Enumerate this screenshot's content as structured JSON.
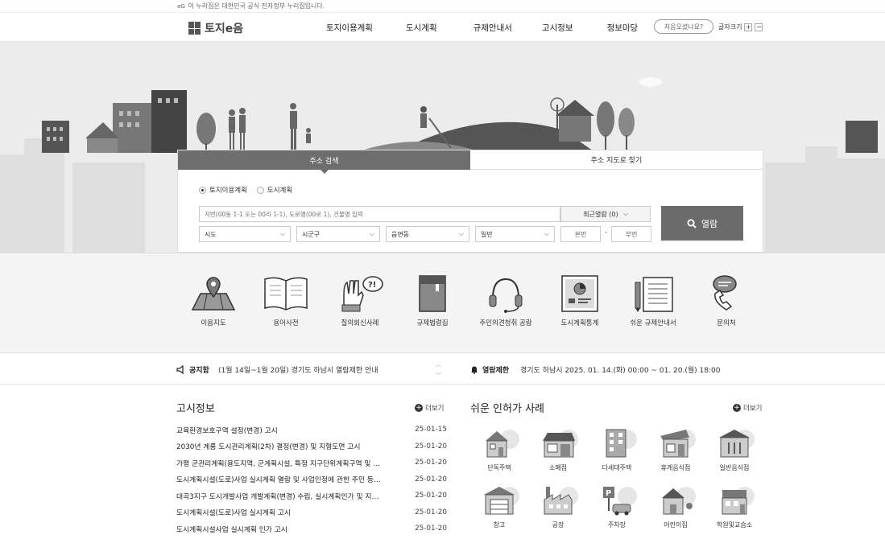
{
  "topbar": {
    "logo_text": "eG",
    "text": "이 누리집은 대한민국 공식 전자정부 누리집입니다."
  },
  "header": {
    "logo": "토지e음",
    "nav": [
      "토지이용계획",
      "도시계획",
      "규제안내서",
      "고시정보",
      "정보마당"
    ],
    "search_placeholder": "처음오셨나요?",
    "font_size_label": "글자크기",
    "font_plus": "+",
    "font_minus": "−"
  },
  "search": {
    "tabs": [
      "주소 검색",
      "주소 지도로 찾기"
    ],
    "radios": [
      "토지이용계획",
      "도시계획"
    ],
    "address_placeholder": "지번(00동 1-1 또는 00리 1-1), 도로명(00로 1), 건물명 입력",
    "recent": "최근열람 (0)",
    "selects": [
      "시도",
      "시군구",
      "읍면동",
      "일반"
    ],
    "bonbun": "본번",
    "bubun": "부번",
    "dash": "-",
    "view_button": "열람"
  },
  "quick_menu": [
    "이음지도",
    "용어사전",
    "질의회신사례",
    "규제법령집",
    "주민의견청취 공람",
    "도시계획통계",
    "쉬운 규제안내서",
    "문의처"
  ],
  "notice": {
    "label": "공지함",
    "text": "(1월 14일~1월 20일) 경기도 하남시 열람제한 안내",
    "restrict_label": "열람제한",
    "restrict_text": "경기도 하남시 2025. 01. 14.(화) 00:00 ~ 01. 20.(월) 18:00"
  },
  "gosi": {
    "title": "고시정보",
    "more": "더보기",
    "items": [
      {
        "title": "교육환경보호구역 설정(변경) 고시",
        "date": "25-01-15"
      },
      {
        "title": "2030년 계룡 도시관리계획(2차) 결정(변경) 및 지형도면 고시",
        "date": "25-01-20"
      },
      {
        "title": "가평 군관리계획(용도지역, 군계획시설, 특정 지구단위계획구역 및 …",
        "date": "25-01-20"
      },
      {
        "title": "도시계획시설(도로)사업 실시계획 열람 및 사업인정에 관한 주민 등…",
        "date": "25-01-20"
      },
      {
        "title": "대곡3지구 도시개발사업 개발계획(변경) 수립, 실시계획인가 및 지…",
        "date": "25-01-20"
      },
      {
        "title": "도시계획시설(도로)사업 실시계획 고시",
        "date": "25-01-20"
      },
      {
        "title": "도시계획시설사업 실시계획 인가 고시",
        "date": "25-01-20"
      }
    ]
  },
  "cases": {
    "title": "쉬운 인허가 사례",
    "more": "더보기",
    "items": [
      "단독주택",
      "소매점",
      "다세대주택",
      "휴게음식점",
      "일반음식점",
      "창고",
      "공장",
      "주차장",
      "어린이집",
      "학원및교습소"
    ]
  }
}
